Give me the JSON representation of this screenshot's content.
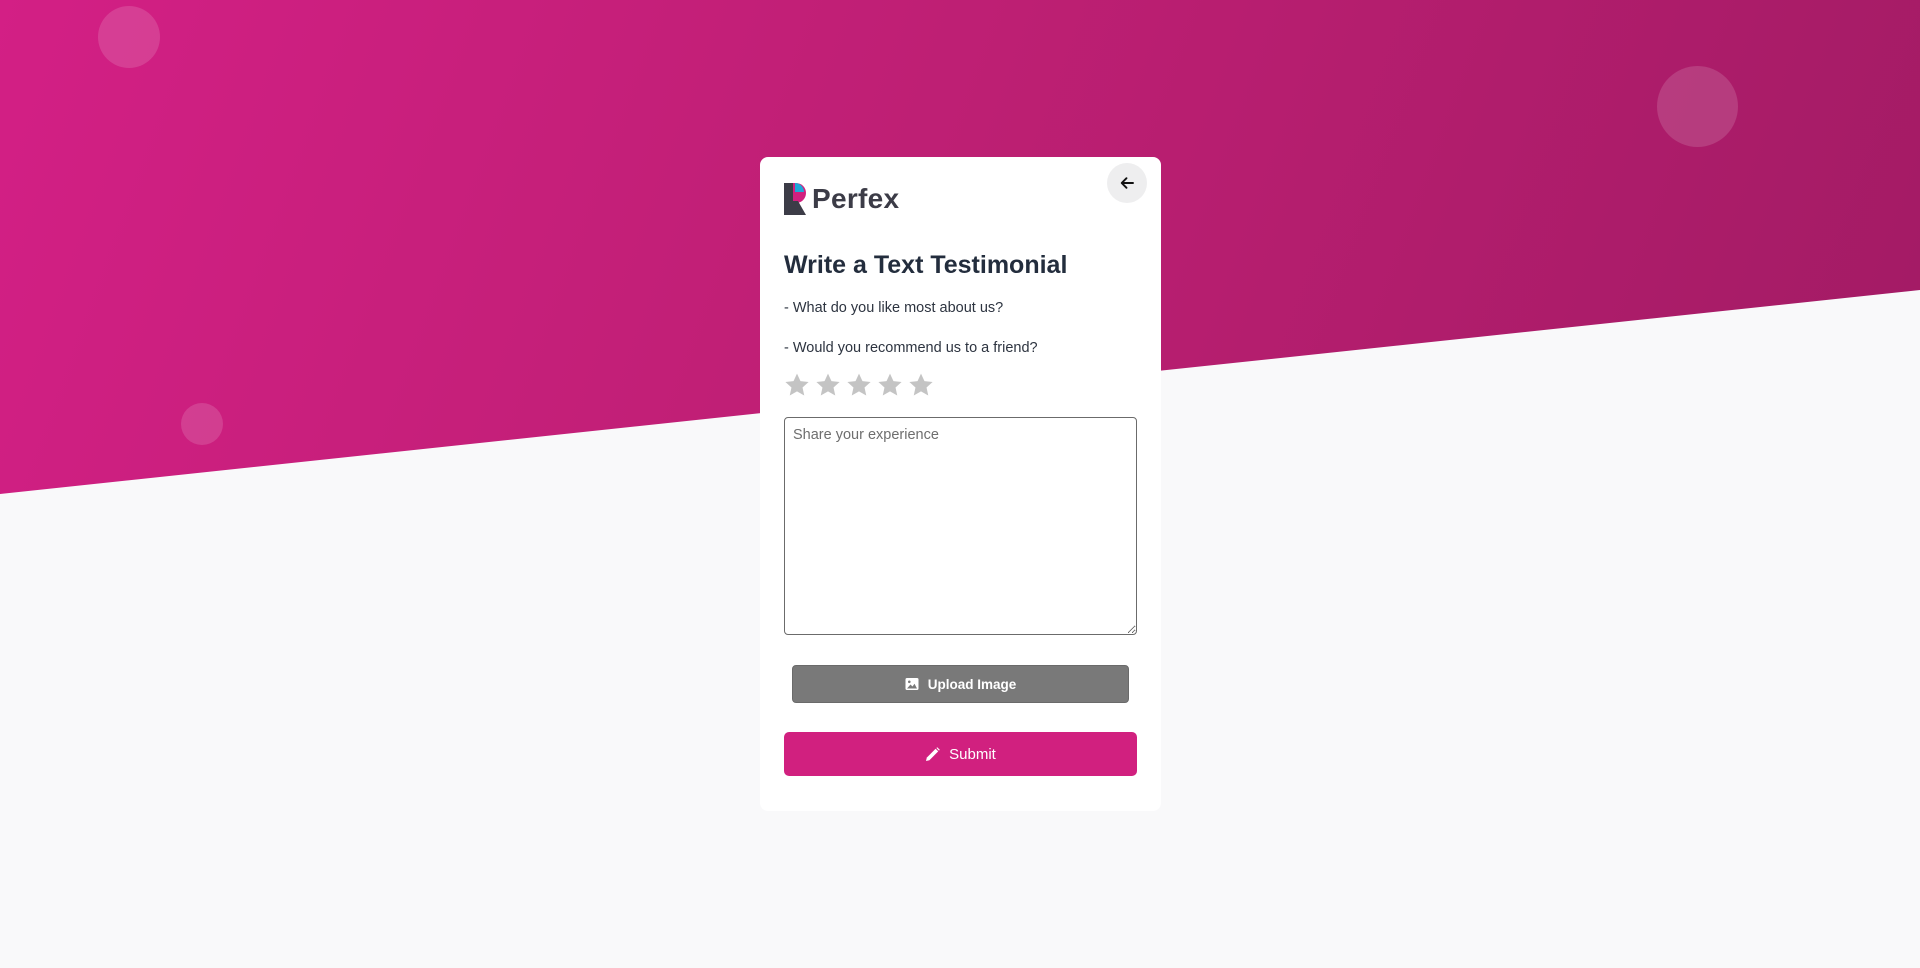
{
  "brand": {
    "name": "Perfex",
    "accent": "#d1207f",
    "logo_colors": [
      "#d1207f",
      "#1fa7d8",
      "#3c3c47"
    ]
  },
  "header": {
    "back_icon": "arrow-left-icon"
  },
  "form": {
    "title": "Write a Text Testimonial",
    "questions": [
      "- What do you like most about us?",
      "- Would you recommend us to a friend?"
    ],
    "rating": {
      "max": 5,
      "value": 0,
      "star_color": "#c4c4c4"
    },
    "experience": {
      "placeholder": "Share your experience",
      "value": ""
    },
    "upload": {
      "label": "Upload Image",
      "icon": "image-icon"
    },
    "submit": {
      "label": "Submit",
      "icon": "pencil-icon"
    }
  }
}
